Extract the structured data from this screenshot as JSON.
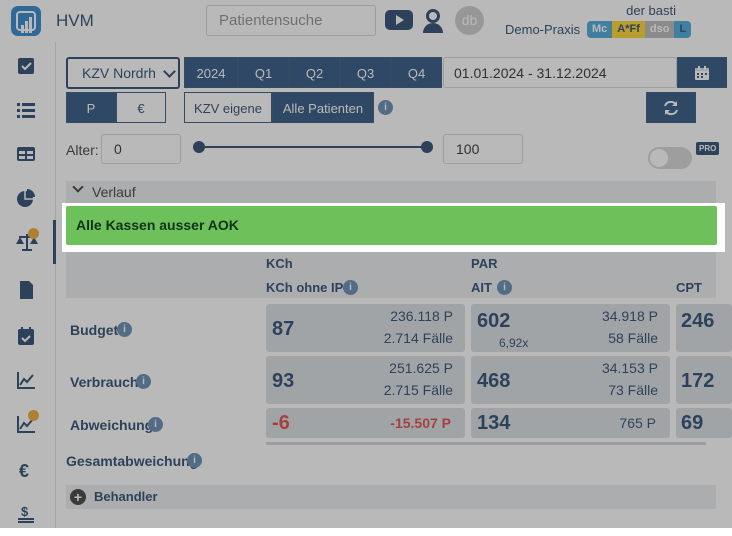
{
  "header": {
    "app_title": "HVM",
    "search_placeholder": "Patientensuche",
    "avatar_initials": "db",
    "user_name": "der basti",
    "practice_label": "Demo-Praxis",
    "badges": [
      {
        "label": "Mc",
        "bg": "#3ea2d8",
        "fg": "#ffffff"
      },
      {
        "label": "A*Ff",
        "bg": "#ffd21f",
        "fg": "#1e3f66"
      },
      {
        "label": "dso",
        "bg": "#b5b5b5",
        "fg": "#ffffff"
      },
      {
        "label": "L",
        "bg": "#3ea2d8",
        "fg": "#1e3f66"
      }
    ]
  },
  "sidebar": {
    "items": [
      {
        "name": "checklist-icon"
      },
      {
        "name": "list-icon"
      },
      {
        "name": "table-icon"
      },
      {
        "name": "pie-chart-icon"
      },
      {
        "name": "scale-icon",
        "active": true,
        "badge": true
      },
      {
        "name": "document-icon"
      },
      {
        "name": "calendar-icon"
      },
      {
        "name": "line-chart-icon"
      },
      {
        "name": "line-chart-badge-icon",
        "badge": true
      },
      {
        "name": "euro-icon"
      },
      {
        "name": "dollar-bars-icon"
      }
    ]
  },
  "filters": {
    "kzv_select": "KZV Nordrh",
    "year": "2024",
    "quarters": [
      "Q1",
      "Q2",
      "Q3",
      "Q4"
    ],
    "date_range": "01.01.2024 - 31.12.2024",
    "mode_buttons": [
      "P",
      "€"
    ],
    "scope_buttons": [
      "KZV eigene",
      "Alle Patienten"
    ],
    "age_label": "Alter:",
    "age_min": "0",
    "age_max": "100",
    "pro_badge": "PRO"
  },
  "verlauf": {
    "label": "Verlauf",
    "banner": "Alle Kassen ausser AOK"
  },
  "table": {
    "groups": [
      "KCh",
      "PAR"
    ],
    "columns": [
      "KCh ohne IP",
      "AIT",
      "CPT"
    ],
    "rows": {
      "budget": {
        "label": "Budget",
        "kch_main": "87",
        "kch_points": "236.118 P",
        "kch_cases": "2.714 Fälle",
        "ait_main": "602",
        "ait_sub": "6,92x",
        "ait_points": "34.918 P",
        "ait_cases": "58 Fälle",
        "cpt_main": "246"
      },
      "verbrauch": {
        "label": "Verbrauch",
        "kch_main": "93",
        "kch_points": "251.625 P",
        "kch_cases": "2.715 Fälle",
        "ait_main": "468",
        "ait_points": "34.153 P",
        "ait_cases": "73 Fälle",
        "cpt_main": "172"
      },
      "abweichung": {
        "label": "Abweichung",
        "kch_main": "-6",
        "kch_points": "-15.507 P",
        "ait_main": "134",
        "ait_points": "765 P",
        "cpt_main": "69"
      }
    },
    "gesamt_label": "Gesamtabweichung",
    "behandler_label": "Behandler"
  }
}
